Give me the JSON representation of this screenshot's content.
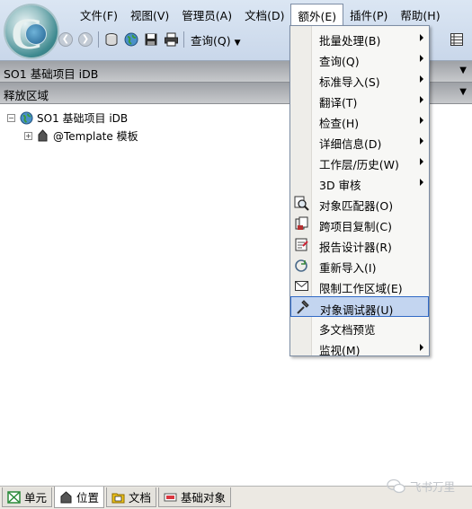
{
  "menubar": [
    {
      "label": "文件(F)"
    },
    {
      "label": "视图(V)"
    },
    {
      "label": "管理员(A)"
    },
    {
      "label": "文档(D)"
    },
    {
      "label": "额外(E)"
    },
    {
      "label": "插件(P)"
    },
    {
      "label": "帮助(H)"
    }
  ],
  "toolbar": {
    "query_label": "查询(Q)"
  },
  "panel1": {
    "title": "SO1  基础项目 iDB"
  },
  "panel2": {
    "title": "释放区域"
  },
  "tree": {
    "root_label": "SO1  基础项目 iDB",
    "child_label": "@Template   模板",
    "expand_minus": "−",
    "expand_plus": "+"
  },
  "dropdown": [
    {
      "label": "批量处理(B)",
      "submenu": true
    },
    {
      "label": "查询(Q)",
      "submenu": true
    },
    {
      "label": "标准导入(S)",
      "submenu": true
    },
    {
      "label": "翻译(T)",
      "submenu": true
    },
    {
      "label": "检查(H)",
      "submenu": true
    },
    {
      "label": "详细信息(D)",
      "submenu": true
    },
    {
      "label": "工作层/历史(W)",
      "submenu": true
    },
    {
      "label": "3D 审核",
      "submenu": true
    },
    {
      "label": "对象匹配器(O)",
      "icon": "magnifier-icon"
    },
    {
      "label": "跨项目复制(C)",
      "icon": "copy-icon"
    },
    {
      "label": "报告设计器(R)",
      "icon": "report-icon"
    },
    {
      "label": "重新导入(I)",
      "icon": "reimport-icon"
    },
    {
      "label": "限制工作区域(E)",
      "icon": "envelope-icon"
    },
    {
      "label": "对象调试器(U)",
      "icon": "hammer-icon",
      "highlighted": true
    },
    {
      "label": "多文档预览"
    },
    {
      "label": "监视(M)",
      "submenu": true
    }
  ],
  "tabs": [
    {
      "label": "单元",
      "icon": "cell-icon"
    },
    {
      "label": "位置",
      "icon": "location-icon",
      "active": true
    },
    {
      "label": "文档",
      "icon": "document-folder-icon"
    },
    {
      "label": "基础对象",
      "icon": "base-object-icon"
    }
  ],
  "watermark": {
    "text": "飞书万里"
  },
  "colors": {
    "highlight": "#c3d5f0",
    "highlight_border": "#316ac5",
    "topbar": "#dbe6f3"
  }
}
